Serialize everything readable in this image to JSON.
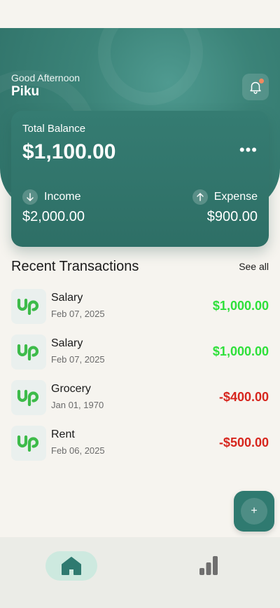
{
  "header": {
    "greeting": "Good Afternoon",
    "username": "Piku",
    "notification_icon": "bell-icon"
  },
  "balance": {
    "label": "Total Balance",
    "amount": "$1,100.00",
    "more_label": "•••",
    "income_label": "Income",
    "income_amount": "$2,000.00",
    "income_icon": "arrow-down",
    "expense_label": "Expense",
    "expense_amount": "$900.00",
    "expense_icon": "arrow-up"
  },
  "transactions_section": {
    "title": "Recent Transactions",
    "see_all_label": "See all"
  },
  "transactions": [
    {
      "name": "Salary",
      "date": "Feb 07, 2025",
      "amount": "$1,000.00",
      "type": "income",
      "icon": "upwork-logo"
    },
    {
      "name": "Salary",
      "date": "Feb 07, 2025",
      "amount": "$1,000.00",
      "type": "income",
      "icon": "upwork-logo"
    },
    {
      "name": "Grocery",
      "date": "Jan 01, 1970",
      "amount": "-$400.00",
      "type": "expense",
      "icon": "upwork-logo"
    },
    {
      "name": "Rent",
      "date": "Feb 06, 2025",
      "amount": "-$500.00",
      "type": "expense",
      "icon": "upwork-logo"
    }
  ],
  "fab": {
    "label": "+"
  },
  "nav": {
    "home_icon": "home-icon",
    "stats_icon": "bar-chart-icon"
  },
  "colors": {
    "primary": "#2f7a70",
    "income": "#2ee03a",
    "expense": "#d7261e",
    "background": "#f6f4ef"
  }
}
